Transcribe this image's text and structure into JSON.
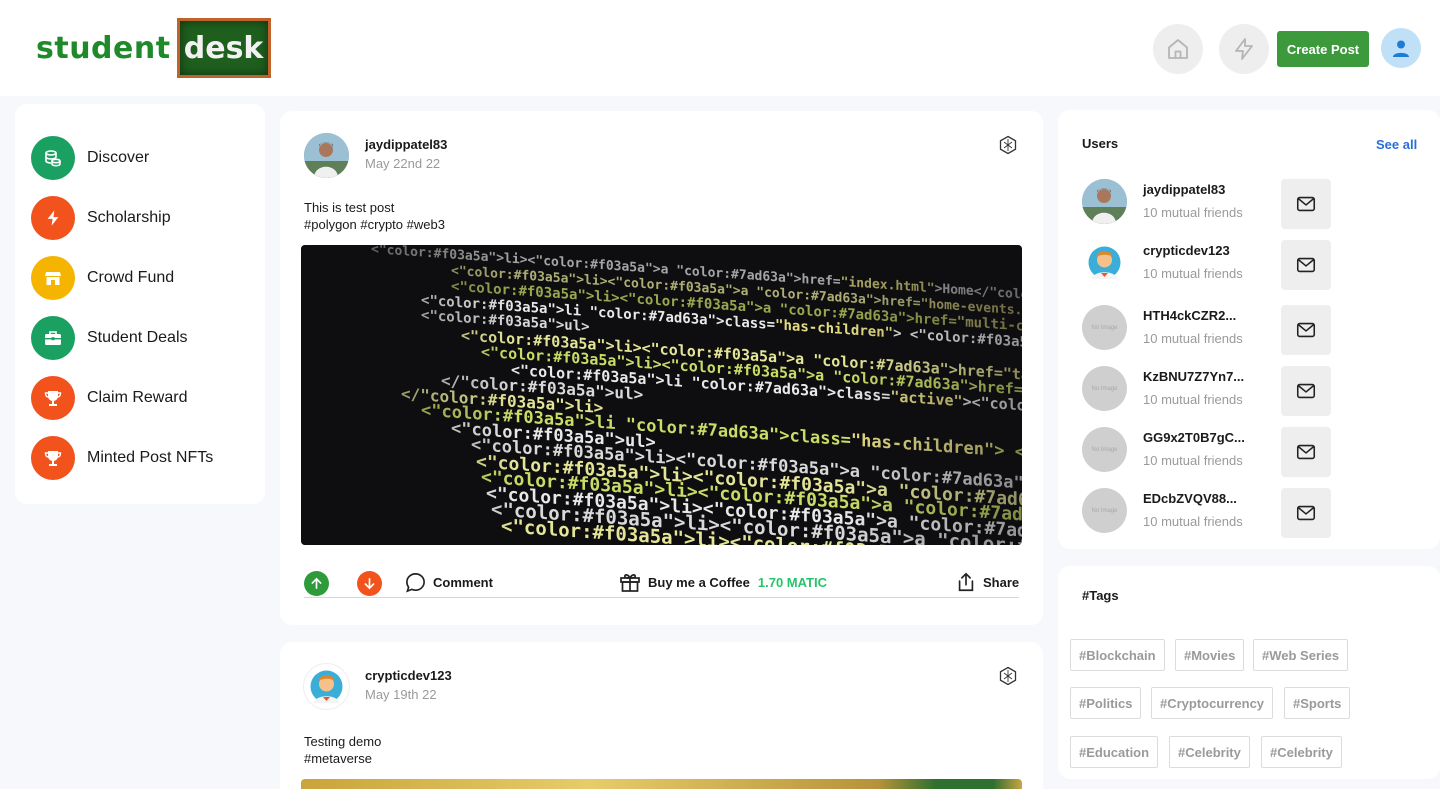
{
  "brand": {
    "word1": "student",
    "word2": "desk"
  },
  "header": {
    "create_post": "Create Post",
    "icons": [
      "home-icon",
      "lightning-icon",
      "user-icon"
    ]
  },
  "sidebar": {
    "items": [
      {
        "label": "Discover",
        "icon": "coins-icon",
        "color": "#1aa061"
      },
      {
        "label": "Scholarship",
        "icon": "lightning-icon",
        "color": "#f2521c"
      },
      {
        "label": "Crowd Fund",
        "icon": "store-icon",
        "color": "#f5b400"
      },
      {
        "label": "Student Deals",
        "icon": "briefcase-icon",
        "color": "#1aa061"
      },
      {
        "label": "Claim Reward",
        "icon": "trophy-icon",
        "color": "#f2521c"
      },
      {
        "label": "Minted Post NFTs",
        "icon": "trophy-icon",
        "color": "#f2521c"
      }
    ]
  },
  "posts": [
    {
      "user": "jaydippatel83",
      "date": "May 22nd 22",
      "text": "This is test post",
      "tags": "#polygon #crypto #web3",
      "code_lines": [
        "<li><a href=\"index.html\">Home</a></li>",
        "<li><a href=\"home-events.html\">Home Events</a></li>",
        "<li><a href=\"multi-col-menu.html\">Multiple Column Menu on Larger Viewports",
        "<li class=\"has-children\"> <a href=\"#\" class=\"current\">Header Options</a>",
        "<ul>",
        "<li><a href=\"tall-button-header.html\">Tall Button Header</a></li>",
        "<li><a href=\"image-logo.html\">Image Logo</a></li>",
        "<li class=\"active\"><a href=\"tall-logo.html\">Tall Logo Image</a>",
        "</ul>",
        "</li>",
        "<li class=\"has-children\"> <a href=\"#\">Carousels</a>",
        "<ul>",
        "<li><a href=\"variable-width-slider.html\">Variable Image Width</a>",
        "<li><a href=\"testimonial-slider.html\">Testimonial Slider</a>",
        "<li><a href=\"featured-work-slider.html\">Featured Work Slider</a>",
        "<li><a href=\"equal-column-slider.html\">Equal Column Slider</a>",
        "<li><a href=\"video-slider.html\">Video Slider</a></li>",
        "<li><a href=\"mini-bootstrap-carousel.html\">Mini Slider</a>"
      ],
      "actions": {
        "comment": "Comment",
        "coffee": "Buy me a Coffee",
        "coffee_amount": "1.70 MATIC",
        "share": "Share"
      }
    },
    {
      "user": "crypticdev123",
      "date": "May 19th 22",
      "text": "Testing demo",
      "tags": "#metaverse"
    }
  ],
  "users_panel": {
    "title": "Users",
    "see_all": "See all",
    "users": [
      {
        "name": "jaydippatel83",
        "mutual": "10 mutual friends",
        "avatar": "photo"
      },
      {
        "name": "crypticdev123",
        "mutual": "10 mutual friends",
        "avatar": "cartoon"
      },
      {
        "name": "HTH4ckCZR2...",
        "mutual": "10 mutual friends",
        "avatar": "placeholder"
      },
      {
        "name": "KzBNU7Z7Yn7...",
        "mutual": "10 mutual friends",
        "avatar": "placeholder"
      },
      {
        "name": "GG9x2T0B7gC...",
        "mutual": "10 mutual friends",
        "avatar": "placeholder"
      },
      {
        "name": "EDcbZVQV88...",
        "mutual": "10 mutual friends",
        "avatar": "placeholder"
      }
    ],
    "placeholder_text": "No Image"
  },
  "tags_panel": {
    "title": "#Tags",
    "tags": [
      "#Blockchain",
      "#Movies",
      "#Web Series",
      "#Politics",
      "#Cryptocurrency",
      "#Sports",
      "#Education",
      "#Celebrity",
      "#Celebrity"
    ]
  },
  "colors": {
    "brand_green": "#3c9a3c",
    "link_blue": "#2b6fd6",
    "matic_green": "#25c46a",
    "upvote": "#2e9a3a",
    "downvote": "#f2521c"
  }
}
